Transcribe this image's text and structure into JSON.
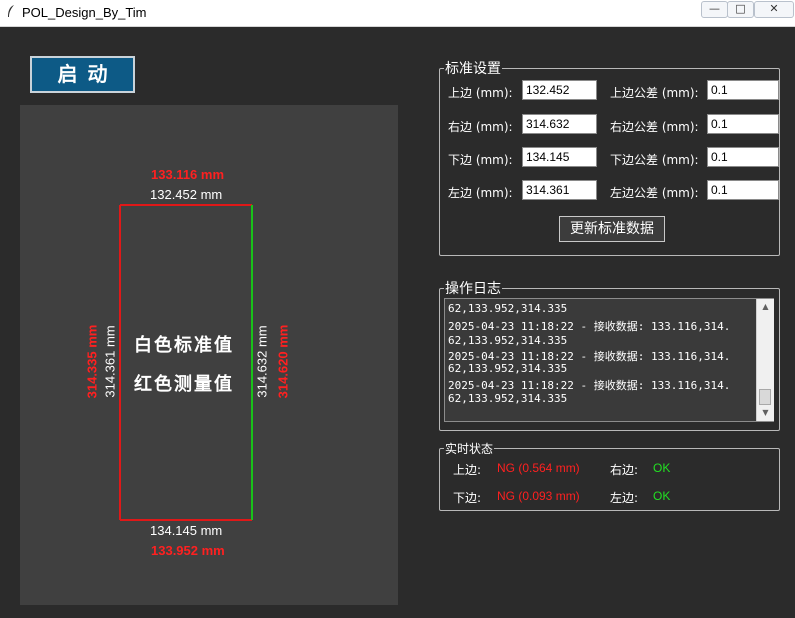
{
  "window": {
    "title": "POL_Design_By_Tim",
    "app_icon": "feather-icon",
    "controls": {
      "minimize": "—",
      "maximize": "□",
      "close": "✕"
    }
  },
  "start_button": {
    "label": "启动"
  },
  "measurement": {
    "center_line1": "白色标准值",
    "center_line2": "红色测量值",
    "top_measured": "133.116 mm",
    "top_standard": "132.452 mm",
    "bottom_standard": "134.145 mm",
    "bottom_measured": "133.952 mm",
    "left_measured": "314.335 mm",
    "left_standard": "314.361 mm",
    "right_standard": "314.632 mm",
    "right_measured": "314.620 mm",
    "colors": {
      "standard": "#ffffff",
      "measured": "#ff2020",
      "frame_red": "#e01818",
      "frame_ok": "#19c219"
    }
  },
  "standards": {
    "legend": "标准设置",
    "rows": [
      {
        "label": "上边 (mm):",
        "value": "132.452",
        "tol_label": "上边公差 (mm):",
        "tol_value": "0.1"
      },
      {
        "label": "右边 (mm):",
        "value": "314.632",
        "tol_label": "右边公差 (mm):",
        "tol_value": "0.1"
      },
      {
        "label": "下边 (mm):",
        "value": "134.145",
        "tol_label": "下边公差 (mm):",
        "tol_value": "0.1"
      },
      {
        "label": "左边 (mm):",
        "value": "314.361",
        "tol_label": "左边公差 (mm):",
        "tol_value": "0.1"
      }
    ],
    "update_button": "更新标准数据"
  },
  "log": {
    "legend": "操作日志",
    "lines": [
      "62,133.952,314.335",
      "2025-04-23 11:18:22 - 接收数据: 133.116,314.",
      "62,133.952,314.335",
      "2025-04-23 11:18:22 - 接收数据: 133.116,314.",
      "62,133.952,314.335",
      "2025-04-23 11:18:22 - 接收数据: 133.116,314.",
      "62,133.952,314.335"
    ]
  },
  "status": {
    "legend": "实时状态",
    "top_label": "上边:",
    "top_value": "NG (0.564 mm)",
    "right_label": "右边:",
    "right_value": "OK",
    "bottom_label": "下边:",
    "bottom_value": "NG (0.093 mm)",
    "left_label": "左边:",
    "left_value": "OK",
    "colors": {
      "ng": "#ff2020",
      "ok": "#22e022"
    }
  }
}
